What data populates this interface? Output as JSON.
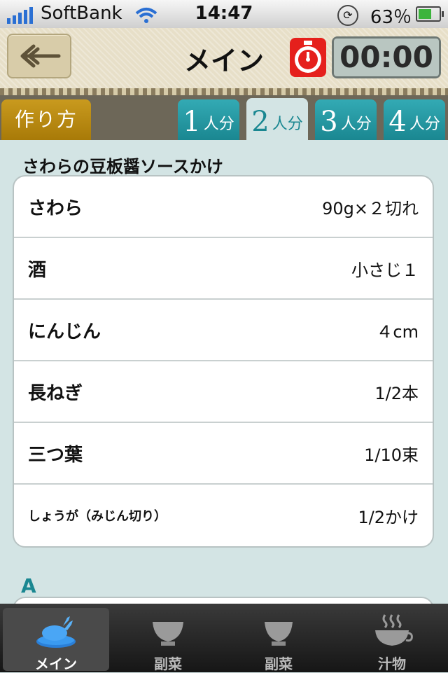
{
  "status_bar": {
    "carrier": "SoftBank",
    "time": "14:47",
    "battery": "63％"
  },
  "header": {
    "title": "メイン",
    "timer": "00:00"
  },
  "tabs": {
    "how_to": "作り方",
    "servings": [
      {
        "num": "1",
        "unit": "人分"
      },
      {
        "num": "2",
        "unit": "人分"
      },
      {
        "num": "3",
        "unit": "人分"
      },
      {
        "num": "4",
        "unit": "人分"
      }
    ],
    "selected_serving": "2"
  },
  "recipe": {
    "dish_name": "さわらの豆板醤ソースかけ",
    "ingredients": [
      {
        "name": "さわら",
        "amount": "90g×２切れ"
      },
      {
        "name": "酒",
        "amount": "小さじ１"
      },
      {
        "name": "にんじん",
        "amount": "４cm"
      },
      {
        "name": "長ねぎ",
        "amount": "1/2本"
      },
      {
        "name": "三つ葉",
        "amount": "1/10束"
      },
      {
        "name": "しょうが（みじん切り）",
        "amount": "1/2かけ"
      }
    ],
    "section_a": "A"
  },
  "tab_bar": [
    {
      "label": "メイン",
      "icon": "main-dish-icon",
      "selected": true
    },
    {
      "label": "副菜",
      "icon": "side-bowl-icon",
      "selected": false
    },
    {
      "label": "副菜",
      "icon": "side-bowl-icon",
      "selected": false
    },
    {
      "label": "汁物",
      "icon": "soup-icon",
      "selected": false
    }
  ],
  "colors": {
    "teal": "#1a8791",
    "gold": "#c99a1e",
    "background": "#d3e4e4"
  }
}
